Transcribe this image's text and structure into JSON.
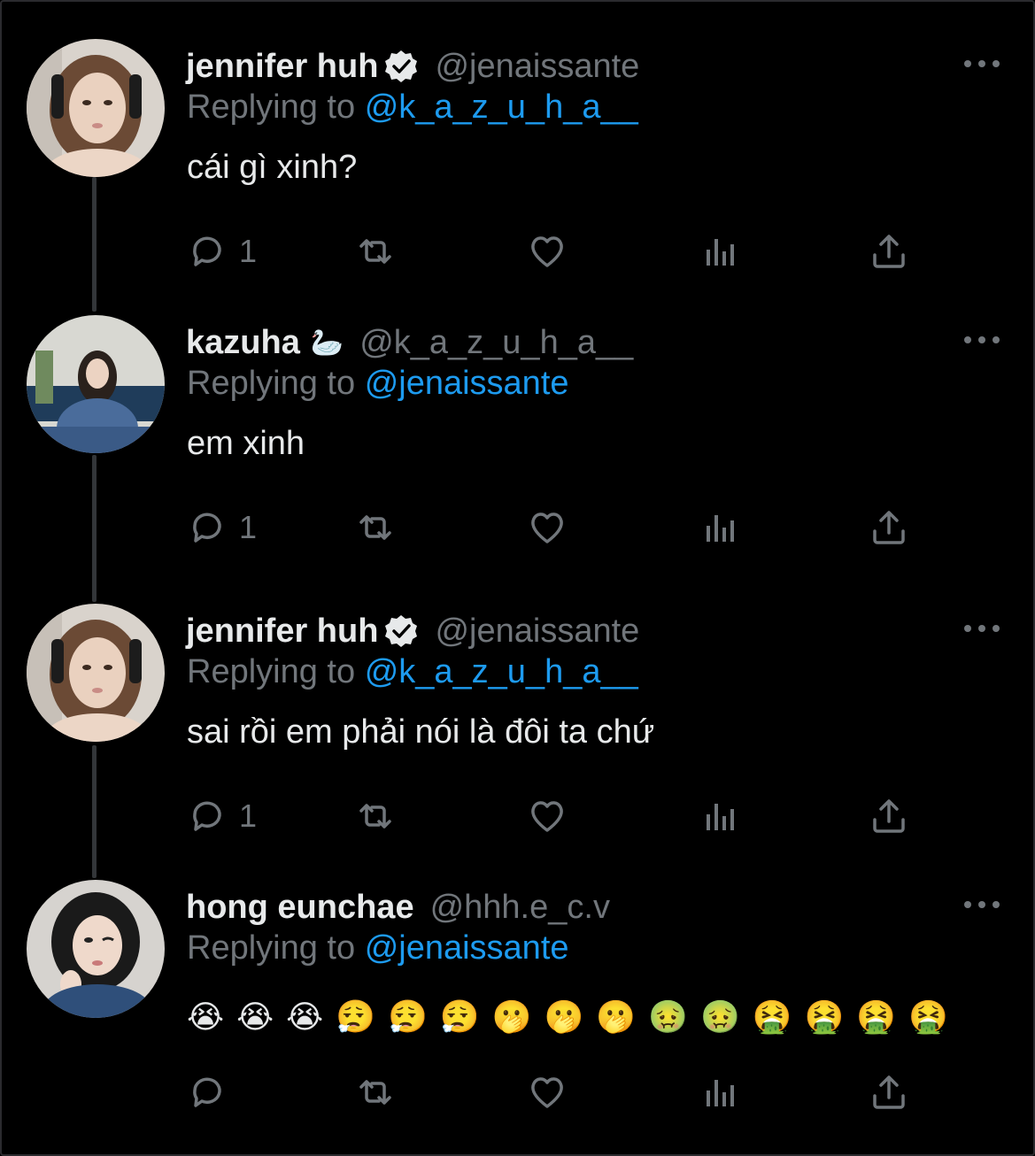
{
  "tweets": [
    {
      "name": "jennifer huh",
      "verified": true,
      "emoji_after_name": "",
      "handle": "@jenaissante",
      "replying_label": "Replying to",
      "replying_to": "@k_a_z_u_h_a__",
      "text": "cái gì xinh?",
      "reply_count": "1",
      "avatar_icon": "avatar-photo-jennifer"
    },
    {
      "name": "kazuha",
      "verified": false,
      "emoji_after_name": "🦢",
      "handle": "@k_a_z_u_h_a__",
      "replying_label": "Replying to",
      "replying_to": "@jenaissante",
      "text": "em xinh",
      "reply_count": "1",
      "avatar_icon": "avatar-photo-kazuha"
    },
    {
      "name": "jennifer huh",
      "verified": true,
      "emoji_after_name": "",
      "handle": "@jenaissante",
      "replying_label": "Replying to",
      "replying_to": "@k_a_z_u_h_a__",
      "text": "sai rồi em phải nói là đôi ta chứ",
      "reply_count": "1",
      "avatar_icon": "avatar-photo-jennifer"
    },
    {
      "name": "hong eunchae",
      "verified": false,
      "emoji_after_name": "",
      "handle": "@hhh.e_c.v",
      "replying_label": "Replying to",
      "replying_to": "@jenaissante",
      "text": "😭😭😭😮‍💨😮‍💨😮‍💨🫢🫢🫢🤢🤢🤮🤮🤮🤮",
      "reply_count": "",
      "avatar_icon": "avatar-photo-eunchae"
    }
  ],
  "icons": {
    "reply": "reply-icon",
    "retweet": "retweet-icon",
    "like": "heart-icon",
    "views": "views-icon",
    "share": "share-icon",
    "more": "more-icon",
    "verified": "verified-badge-icon"
  },
  "colors": {
    "background": "#000000",
    "text": "#e7e9ea",
    "muted": "#71767b",
    "accent": "#1d9bf0",
    "thread_line": "#333639"
  }
}
